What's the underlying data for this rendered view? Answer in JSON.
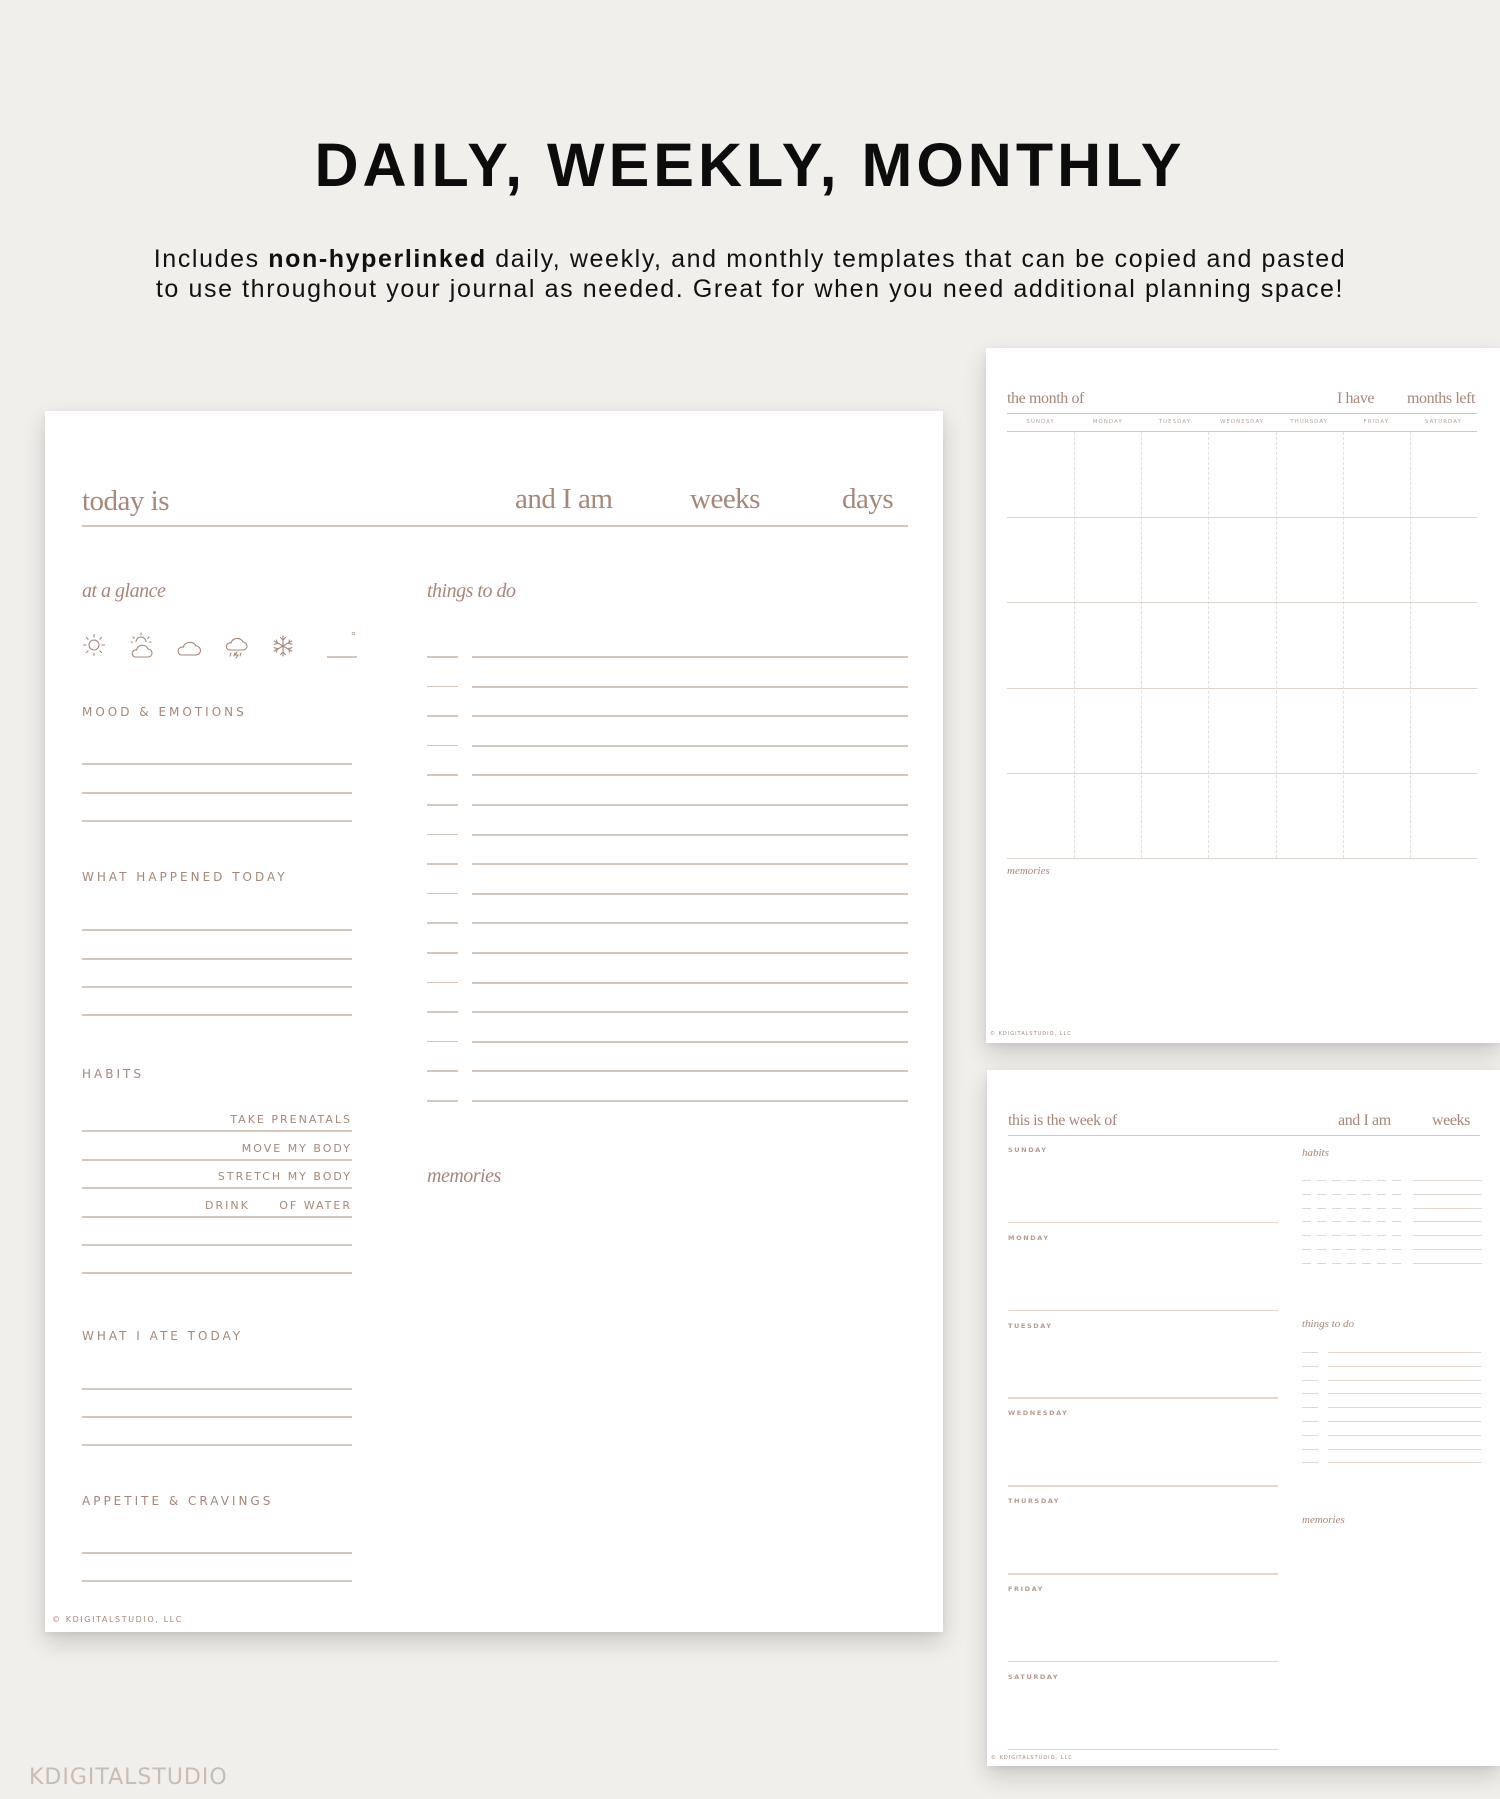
{
  "header": {
    "title": "DAILY, WEEKLY, MONTHLY",
    "subtitle_pre": "Includes ",
    "subtitle_bold": "non-hyperlinked",
    "subtitle_post1": " daily, weekly, and monthly templates that can be copied and pasted",
    "subtitle_line2": "to use throughout your journal as needed. Great for when you need additional planning space!"
  },
  "brand": "KDIGITALSTUDIO",
  "colors": {
    "accent": "#a5887a",
    "rule": "#d6c7bd",
    "background": "#f1efeb",
    "page": "#ffffff"
  },
  "daily": {
    "header": {
      "today_is": "today is",
      "and_i_am": "and I am",
      "weeks": "weeks",
      "days": "days"
    },
    "at_a_glance": "at a glance",
    "weather_icons": [
      "sun-icon",
      "partly-cloudy-icon",
      "cloud-icon",
      "storm-icon",
      "snowflake-icon"
    ],
    "degree_symbol": "°",
    "sections": {
      "mood": "MOOD & EMOTIONS",
      "happened": "WHAT HAPPENED TODAY",
      "habits": "HABITS",
      "ate": "WHAT I ATE TODAY",
      "appetite": "APPETITE & CRAVINGS"
    },
    "habits": [
      {
        "label": "TAKE PRENATALS"
      },
      {
        "label": "MOVE MY BODY"
      },
      {
        "label": "STRETCH MY BODY"
      },
      {
        "label_left": "DRINK",
        "label": "OF WATER"
      },
      {
        "label": ""
      },
      {
        "label": ""
      }
    ],
    "things_to_do": "things to do",
    "todo_rows": 16,
    "memories": "memories",
    "footer": "© KDIGITALSTUDIO, LLC"
  },
  "monthly": {
    "header": {
      "month_of": "the month of",
      "i_have": "I have",
      "months_left": "months left"
    },
    "weekdays": [
      "SUNDAY",
      "MONDAY",
      "TUESDAY",
      "WEDNESDAY",
      "THURSDAY",
      "FRIDAY",
      "SATURDAY"
    ],
    "week_rows": 5,
    "memories": "memories",
    "footer": "© KDIGITALSTUDIO, LLC"
  },
  "weekly": {
    "header": {
      "week_of": "this is the week of",
      "and_i_am": "and I am",
      "weeks": "weeks"
    },
    "days": [
      "SUNDAY",
      "MONDAY",
      "TUESDAY",
      "WEDNESDAY",
      "THURSDAY",
      "FRIDAY",
      "SATURDAY"
    ],
    "habits": "habits",
    "habit_rows": 7,
    "habit_checks_per_row": 7,
    "things_to_do": "things to do",
    "todo_rows": 9,
    "memories": "memories",
    "footer": "© KDIGITALSTUDIO, LLC"
  }
}
